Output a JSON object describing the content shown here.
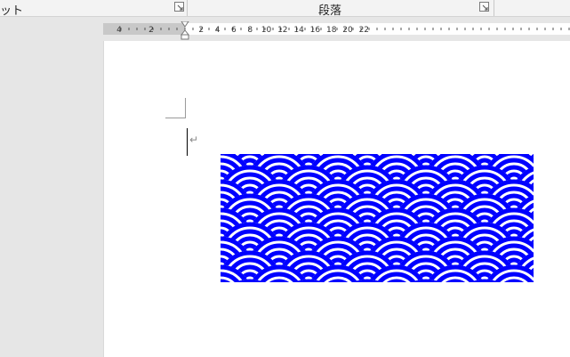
{
  "ribbon": {
    "font_group_label": "ット",
    "paragraph_group_label": "段落",
    "launcher_icon": "dialog-launcher-icon"
  },
  "ruler": {
    "left_numbers": [
      "4",
      "2"
    ],
    "right_numbers": [
      "2",
      "4",
      "6",
      "8",
      "10",
      "12",
      "14",
      "16",
      "18",
      "20",
      "22"
    ]
  },
  "document": {
    "paragraph_mark": "↵",
    "image_name": "seigaiha-wave-pattern",
    "pattern_color": "#0000ff"
  }
}
